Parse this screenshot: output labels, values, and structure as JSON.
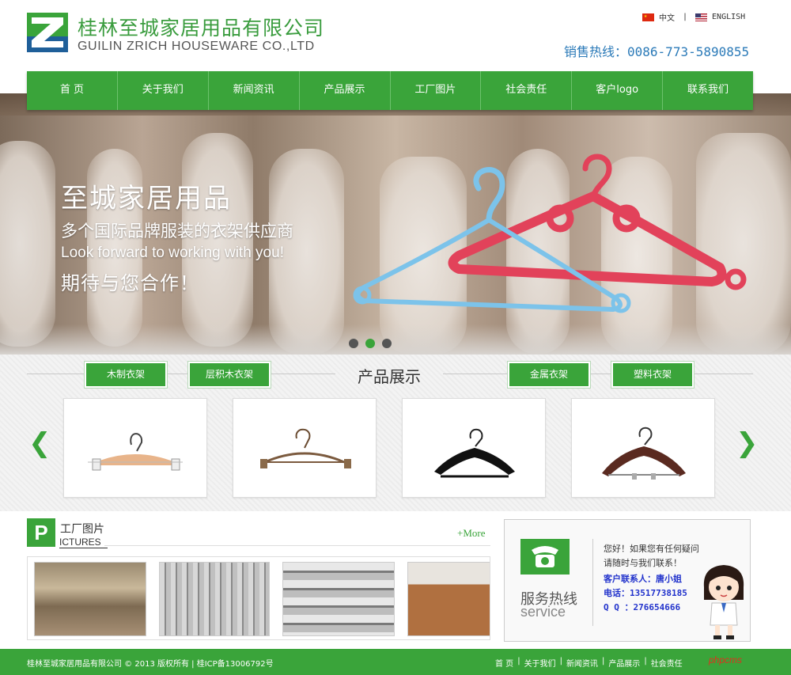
{
  "header": {
    "brand_cn": "桂林至城家居用品有限公司",
    "brand_en": "GUILIN ZRICH HOUSEWARE CO.,LTD",
    "lang_cn": "中文",
    "lang_sep": "|",
    "lang_en": "ENGLISH",
    "hotline_label": "销售热线：",
    "hotline_number": "0086-773-5890855"
  },
  "nav": {
    "items": [
      "首 页",
      "关于我们",
      "新闻资讯",
      "产品展示",
      "工厂图片",
      "社会责任",
      "客户logo",
      "联系我们"
    ]
  },
  "banner": {
    "line1": "至城家居用品",
    "line2": "多个国际品牌服装的衣架供应商",
    "line3": "Look forward to working with you!",
    "line4": "期待与您合作！",
    "slides": 3,
    "active_slide": 2
  },
  "products": {
    "title": "产品展示",
    "categories": [
      "木制衣架",
      "层积木衣架",
      "金属衣架",
      "塑料衣架"
    ],
    "prev_arrow": "❮",
    "next_arrow": "❯"
  },
  "pictures": {
    "badge": "P",
    "title_cn": "工厂图片",
    "title_en": "ICTURES",
    "more": "+More"
  },
  "service": {
    "title": "服务热线",
    "title_en": "service",
    "intro": "您好！如果您有任何疑问请随时与我们联系！",
    "contact_person": "客户联系人：唐小姐",
    "phone": "电话：13517738185",
    "qq": "Q Q ：276654666"
  },
  "footer": {
    "copyright": "桂林至城家居用品有限公司 © 2013 版权所有 | 桂ICP备13006792号",
    "links": [
      "首 页",
      "关于我们",
      "新闻资讯",
      "产品展示",
      "社会责任"
    ],
    "sep": "|",
    "watermark": "phpcms"
  },
  "colors": {
    "brand_green": "#3aa43a",
    "logo_blue": "#1f5f99",
    "hotline_blue": "#2b7ab8"
  }
}
